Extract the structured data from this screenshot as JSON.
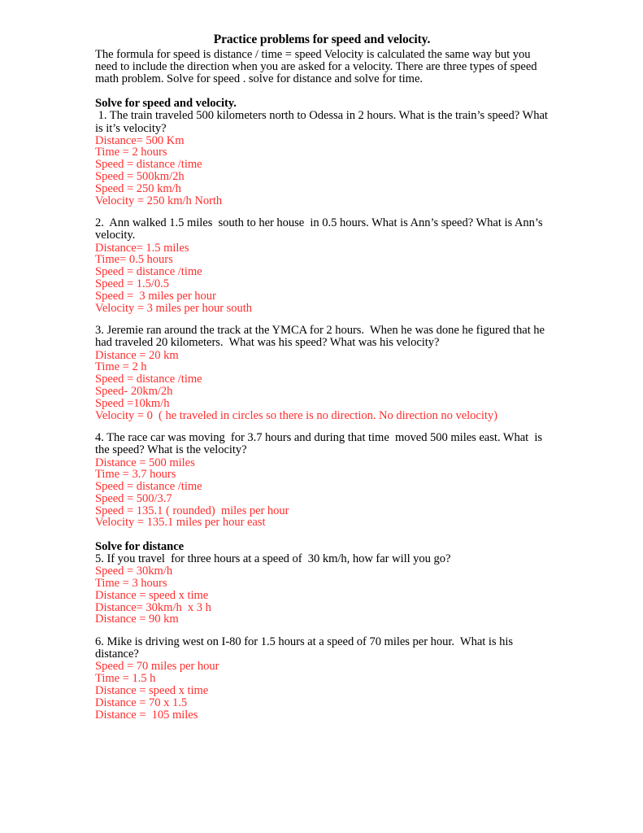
{
  "colors": {
    "answer_red": "#ff2d2d",
    "text_black": "#000000",
    "page_background": "#ffffff"
  },
  "document": {
    "title": "Practice problems for speed and velocity.",
    "intro": "The formula for speed is distance / time = speed   Velocity is calculated the same way  but you need to include the direction when you are asked for a velocity. There are three types of speed math problem. Solve for speed . solve for distance and solve for time."
  },
  "sections": [
    {
      "heading": "Solve for speed and velocity.",
      "problems": [
        {
          "question": " 1. The train traveled 500 kilometers north to Odessa in 2 hours. What is the train’s speed? What is it’s velocity?",
          "answers": [
            "Distance= 500 Km",
            "Time = 2 hours",
            "Speed = distance /time",
            "Speed = 500km/2h",
            "Speed = 250 km/h",
            "Velocity = 250 km/h North"
          ]
        },
        {
          "question": "2.  Ann walked 1.5 miles  south to her house  in 0.5 hours. What is Ann’s speed? What is Ann’s velocity.",
          "answers": [
            "Distance= 1.5 miles",
            "Time= 0.5 hours",
            "Speed = distance /time",
            "Speed = 1.5/0.5",
            "Speed =  3 miles per hour",
            "Velocity = 3 miles per hour south"
          ]
        },
        {
          "question": "3. Jeremie ran around the track at the YMCA for 2 hours.  When he was done he figured that he had traveled 20 kilometers.  What was his speed? What was his velocity?",
          "answers": [
            "Distance = 20 km",
            "Time = 2 h",
            "Speed = distance /time",
            "Speed- 20km/2h",
            "Speed =10km/h",
            "Velocity = 0  ( he traveled in circles so there is no direction. No direction no velocity)"
          ]
        },
        {
          "question": "4. The race car was moving  for 3.7 hours and during that time  moved 500 miles east. What  is the speed? What is the velocity?",
          "answers": [
            "Distance = 500 miles",
            "Time = 3.7 hours",
            "Speed = distance /time",
            "Speed = 500/3.7",
            "Speed = 135.1 ( rounded)  miles per hour",
            "Velocity = 135.1 miles per hour east"
          ]
        }
      ]
    },
    {
      "heading": "Solve for distance",
      "problems": [
        {
          "question": "5. If you travel  for three hours at a speed of  30 km/h, how far will you go?",
          "answers": [
            "Speed = 30km/h",
            "Time = 3 hours",
            "Distance = speed x time",
            "Distance= 30km/h  x 3 h",
            "Distance = 90 km"
          ]
        },
        {
          "question": "6. Mike is driving west on I-80 for 1.5 hours at a speed of 70 miles per hour.  What is his distance?",
          "answers": [
            "Speed = 70 miles per hour",
            "Time = 1.5 h",
            "Distance = speed x time",
            "Distance = 70 x 1.5",
            "Distance =  105 miles"
          ]
        }
      ]
    }
  ]
}
